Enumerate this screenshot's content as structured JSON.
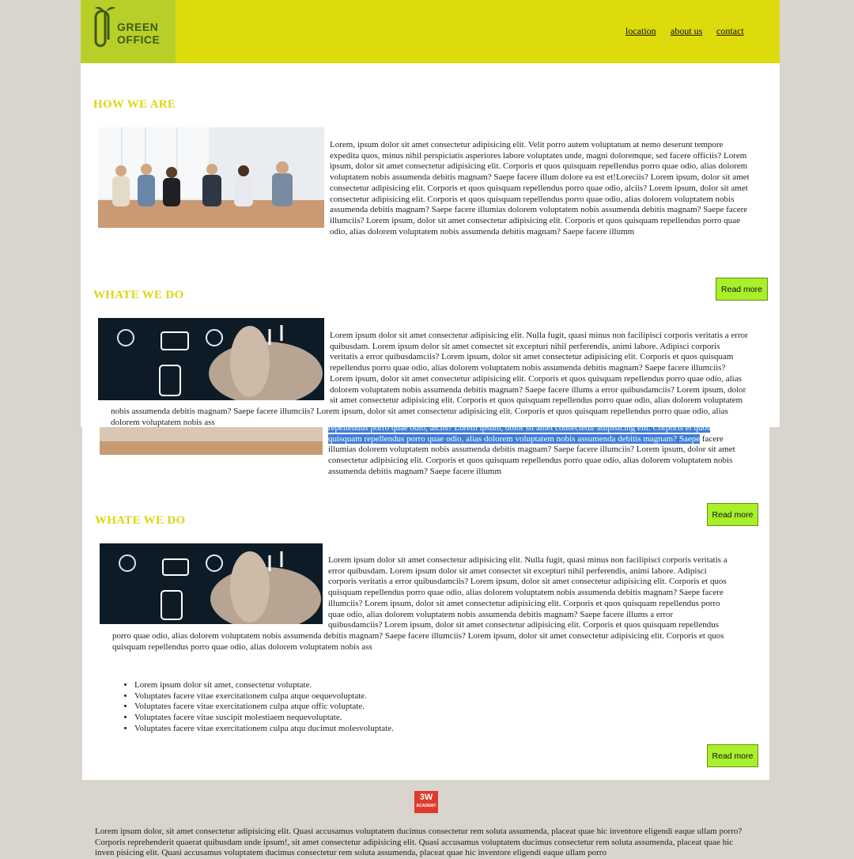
{
  "header": {
    "logo_line1": "GREEN",
    "logo_line2": "OFFICE",
    "nav": [
      "location",
      "about us",
      "contact"
    ]
  },
  "colors": {
    "header": "#dddb0c",
    "heading": "#dcd60f",
    "button": "#a8f02a",
    "selection": "#3e7fd6"
  },
  "sections": [
    {
      "heading": "HOW WE ARE",
      "text": "Lorem, ipsum dolor sit amet consectetur adipisicing elit. Velit porro autem voluptatum at nemo deserunt tempore expedita quos, minus nihil perspiciatis asperiores labore voluptates unde, magni doloremque, sed facere officiis? Lorem ipsum, dolor sit amet consectetur adipisicing elit. Corporis et quos quisquam repellendus porro quae odio, alias dolorem voluptatem nobis assumenda debitis magnam? Saepe facere illum dolore ea est et!Loreciis? Lorem ipsum, dolor sit amet consectetur adipisicing elit. Corporis et quos quisquam repellendus porro quae odio, alciis? Lorem ipsum, dolor sit amet consectetur adipisicing elit. Corporis et quos quisquam repellendus porro quae odio, alias dolorem voluptatem nobis assumenda debitis magnam? Saepe facere illumias dolorem voluptatem nobis assumenda debitis magnam? Saepe facere illumciis? Lorem ipsum, dolor sit amet consectetur adipisicing elit. Corporis et quos quisquam repellendus porro quae odio, alias dolorem voluptatem nobis assumenda debitis magnam? Saepe facere illumm",
      "button": "Read more"
    },
    {
      "heading": "WHATE WE DO",
      "text": "Lorem ipsum dolor sit amet consectetur adipisicing elit. Nulla fugit, quasi minus non facilipisci corporis veritatis a error quibusdam. Lorem ipsum dolor sit amet consectet sit excepturi nihil perferendis, animi labore. Adipisci corporis veritatis a error quibusdamciis? Lorem ipsum, dolor sit amet consectetur adipisicing elit. Corporis et quos quisquam repellendus porro quae odio, alias dolorem voluptatem nobis assumenda debitis magnam? Saepe facere illumciis? Lorem ipsum, dolor sit amet consectetur adipisicing elit. Corporis et quos quisquam repellendus porro quae odio, alias dolorem voluptatem nobis assumenda debitis magnam? Saepe facere illums a error quibusdamciis? Lorem ipsum, dolor sit amet consectetur adipisicing elit. Corporis et quos quisquam repellendus porro quae odio, alias dolorem voluptatem nobis assumenda debitis magnam? Saepe facere illumciis? Lorem ipsum, dolor sit amet consectetur adipisicing elit. Corporis et quos quisquam repellendus porro quae odio, alias dolorem voluptatem nobis ass"
    },
    {
      "overlap_text_before": "repellendus porro quae odio, alciis? Lorem ipsum, dolor sit amet consectetur adipisicing elit. Corporis et quos",
      "overlap_selected": "quisquam repellendus porro quae odio, alias dolorem voluptatem nobis assumenda debitis magnam? Saepe",
      "overlap_text_after": "facere illumias dolorem voluptatem nobis assumenda debitis magnam? Saepe facere illumciis? Lorem ipsum, dolor sit amet consectetur adipisicing elit. Corporis et quos quisquam repellendus porro quae odio, alias dolorem voluptatem nobis assumenda debitis magnam? Saepe facere illumm",
      "button": "Read more"
    },
    {
      "heading": "WHATE WE DO",
      "text": "Lorem ipsum dolor sit amet consectetur adipisicing elit. Nulla fugit, quasi minus non facilipisci corporis veritatis a error quibusdam. Lorem ipsum dolor sit amet consectet sit excepturi nihil perferendis, animi labore. Adipisci corporis veritatis a error quibusdamciis? Lorem ipsum, dolor sit amet consectetur adipisicing elit. Corporis et quos quisquam repellendus porro quae odio, alias dolorem voluptatem nobis assumenda debitis magnam? Saepe facere illumciis? Lorem ipsum, dolor sit amet consectetur adipisicing elit. Corporis et quos quisquam repellendus porro quae odio, alias dolorem voluptatem nobis assumenda debitis magnam? Saepe facere illums a error quibusdamciis? Lorem ipsum, dolor sit amet consectetur adipisicing elit. Corporis et quos quisquam repellendus porro quae odio, alias dolorem voluptatem nobis assumenda debitis magnam? Saepe facere illumciis? Lorem ipsum, dolor sit amet consectetur adipisicing elit. Corporis et quos quisquam repellendus porro quae odio, alias dolorem voluptatem nobis ass",
      "bullets": [
        "Lorem ipsum dolor sit amet, consectetur voluptate.",
        "Voluptates facere vitae exercitationem culpa atque oequevoluptate.",
        "Voluptates facere vitae exercitationem culpa atque offic voluptate.",
        "Voluptates facere vitae suscipit molestiaem nequevoluptate.",
        "Voluptates facere vitae exercitationem culpa atqu ducimut molesvoluptate."
      ],
      "button_a": "Read more",
      "button_b": "Read more"
    }
  ],
  "footer": {
    "badge_top": "3W",
    "badge_bottom": "ACADEMY",
    "text": "Lorem ipsum dolor, sit amet consectetur adipisicing elit. Quasi accusamus voluptatem ducimus consectetur rem soluta assumenda, placeat quae hic inventore eligendi eaque ullam porro? Corporis reprehenderit quaerat quibusdam unde ipsum!, sit amet consectetur adipisicing elit. Quasi accusamus voluptatem ducimus consectetur rem soluta assumenda, placeat quae hic inven pisicing elit. Quasi accusamus voluptatem ducimus consectetur rem soluta assumenda, placeat quae hic inventore eligendi eaque ullam porro"
  }
}
